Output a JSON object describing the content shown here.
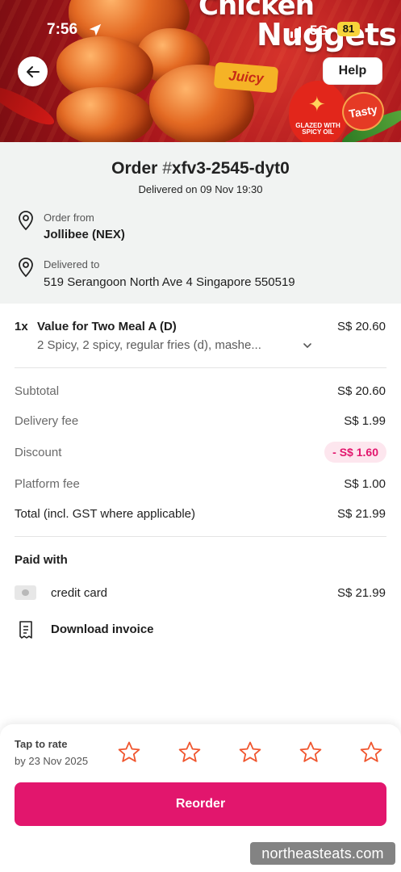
{
  "status_bar": {
    "time": "7:56",
    "network": "5G",
    "battery": "81"
  },
  "hero": {
    "brand_line1": "Chicken",
    "brand_line2": "Nuggets",
    "tag_juicy": "Juicy",
    "tag_glazed": "GLAZED WITH SPICY OIL",
    "tag_tasty": "Tasty",
    "help_label": "Help",
    "back_icon": "arrow-left-icon"
  },
  "order": {
    "title_prefix": "Order ",
    "title_hash": "#",
    "title_id": "xfv3-2545-dyt0",
    "delivered_line": "Delivered on 09 Nov 19:30",
    "from_label": "Order from",
    "restaurant": "Jollibee (NEX)",
    "to_label": "Delivered to",
    "address": "519 Serangoon North Ave 4 Singapore 550519"
  },
  "item": {
    "qty": "1x",
    "name": "Value for Two Meal A (D)",
    "price": "S$ 20.60",
    "description": "2 Spicy, 2 spicy, regular fries (d), mashe..."
  },
  "summary": {
    "subtotal_label": "Subtotal",
    "subtotal_value": "S$ 20.60",
    "delivery_label": "Delivery fee",
    "delivery_value": "S$ 1.99",
    "discount_label": "Discount",
    "discount_value": "- S$ 1.60",
    "platform_label": "Platform fee",
    "platform_value": "S$ 1.00",
    "total_label": "Total (incl. GST where applicable)",
    "total_value": "S$ 21.99"
  },
  "payment": {
    "title": "Paid with",
    "method": "credit card",
    "amount": "S$ 21.99",
    "invoice_label": "Download invoice"
  },
  "rating": {
    "title": "Tap to rate",
    "deadline": "by 23 Nov 2025",
    "stars": 5,
    "accent": "#f0562f"
  },
  "actions": {
    "reorder_label": "Reorder",
    "accent": "#e2166d"
  },
  "watermark": "northeasteats.com"
}
